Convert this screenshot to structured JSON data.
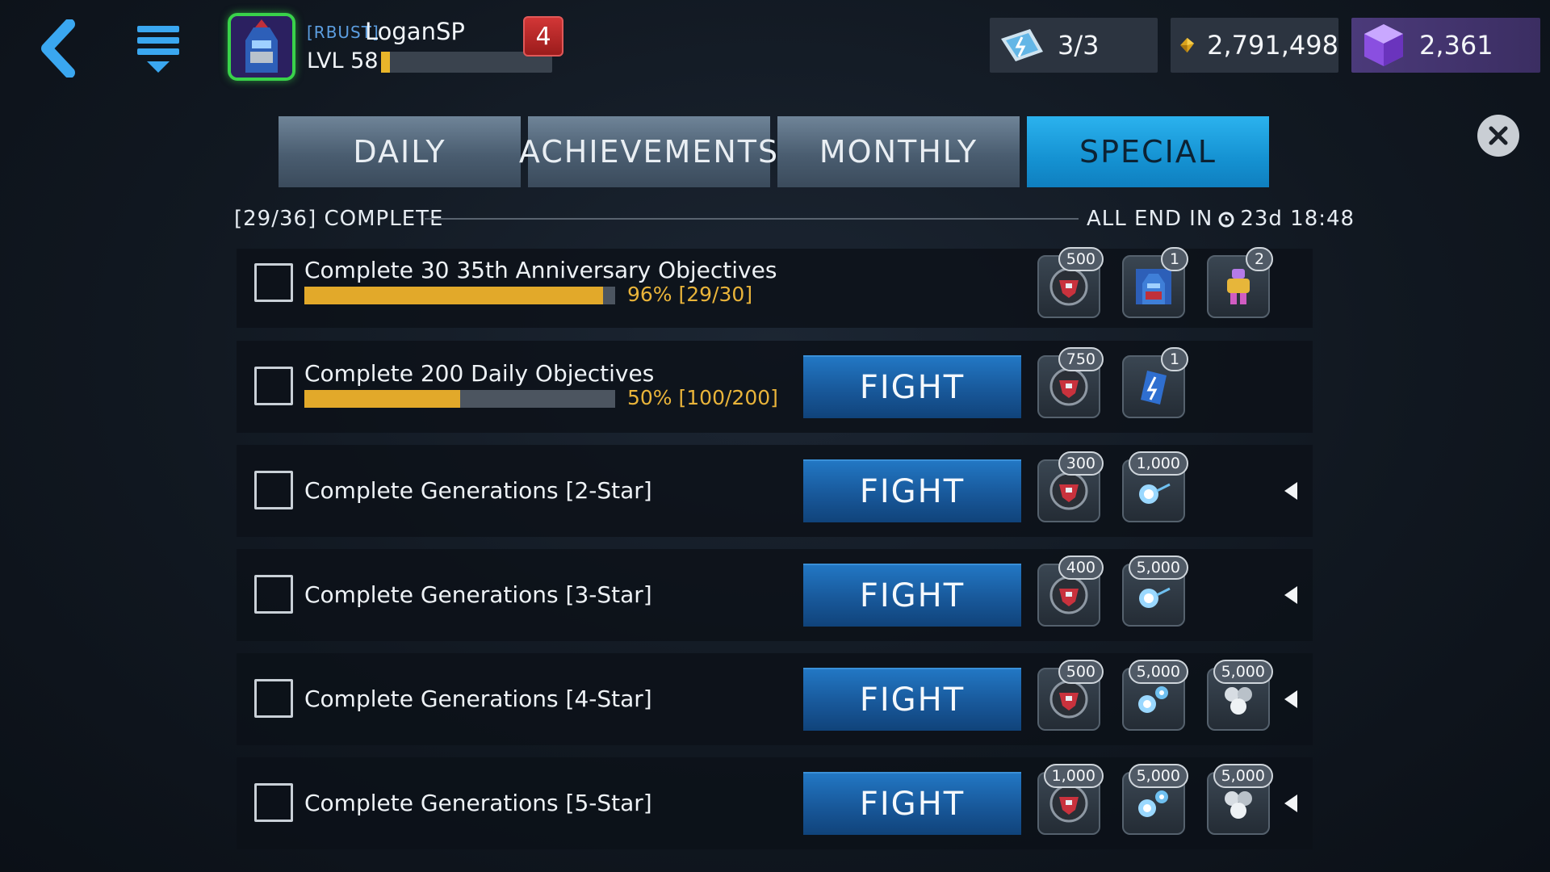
{
  "header": {
    "back_icon": "chevron-left-icon",
    "menu_icon": "menu-icon",
    "player": {
      "alliance_tag": "[RBUST]",
      "name": "LoganSP",
      "level_label": "LVL 58",
      "xp_progress": 0.05,
      "avatar_icon": "optimus-prime-avatar-icon"
    },
    "notification_count": "4",
    "currencies": {
      "energy": {
        "icon": "energy-ticket-icon",
        "value": "3/3"
      },
      "gold": {
        "icon": "gold-crystal-icon",
        "value": "2,791,498"
      },
      "gems": {
        "icon": "purple-gem-icon",
        "value": "2,361"
      }
    }
  },
  "tabs": [
    {
      "label": "DAILY",
      "active": false
    },
    {
      "label": "ACHIEVEMENTS",
      "active": false
    },
    {
      "label": "MONTHLY",
      "active": false
    },
    {
      "label": "SPECIAL",
      "active": true
    }
  ],
  "summary": {
    "complete_text": "[29/36] COMPLETE",
    "end_label": "ALL END IN",
    "end_time": "23d 18:48"
  },
  "objectives": [
    {
      "title": "Complete 30 35th Anniversary Objectives",
      "progress_text": "96% [29/30]",
      "progress": 0.96,
      "fight_label": "",
      "rewards": [
        {
          "icon": "autobot-badge-icon",
          "count": "500"
        },
        {
          "icon": "bot-portrait-icon",
          "count": "1"
        },
        {
          "icon": "figure-token-icon",
          "count": "2"
        }
      ],
      "arrow": false
    },
    {
      "title": "Complete 200 Daily Objectives",
      "progress_text": "50% [100/200]",
      "progress": 0.5,
      "fight_label": "FIGHT",
      "rewards": [
        {
          "icon": "autobot-badge-icon",
          "count": "750"
        },
        {
          "icon": "energon-crystal-icon",
          "count": "1"
        }
      ],
      "arrow": false
    },
    {
      "title": "Complete Generations [2-Star]",
      "fight_label": "FIGHT",
      "rewards": [
        {
          "icon": "autobot-badge-icon",
          "count": "300"
        },
        {
          "icon": "spark-orb-icon",
          "count": "1,000"
        }
      ],
      "arrow": true
    },
    {
      "title": "Complete Generations [3-Star]",
      "fight_label": "FIGHT",
      "rewards": [
        {
          "icon": "autobot-badge-icon",
          "count": "400"
        },
        {
          "icon": "spark-orb-icon",
          "count": "5,000"
        }
      ],
      "arrow": true
    },
    {
      "title": "Complete Generations [4-Star]",
      "fight_label": "FIGHT",
      "rewards": [
        {
          "icon": "autobot-badge-icon",
          "count": "500"
        },
        {
          "icon": "spark-orbs-icon",
          "count": "5,000"
        },
        {
          "icon": "silver-orbs-icon",
          "count": "5,000"
        }
      ],
      "arrow": true
    },
    {
      "title": "Complete Generations [5-Star]",
      "fight_label": "FIGHT",
      "rewards": [
        {
          "icon": "autobot-badge-icon",
          "count": "1,000"
        },
        {
          "icon": "spark-orbs-icon",
          "count": "5,000"
        },
        {
          "icon": "silver-orbs-icon",
          "count": "5,000"
        }
      ],
      "arrow": true
    }
  ],
  "colors": {
    "accent_blue": "#1592d2",
    "progress_gold": "#e2a92a",
    "fight_blue": "#18589a"
  }
}
